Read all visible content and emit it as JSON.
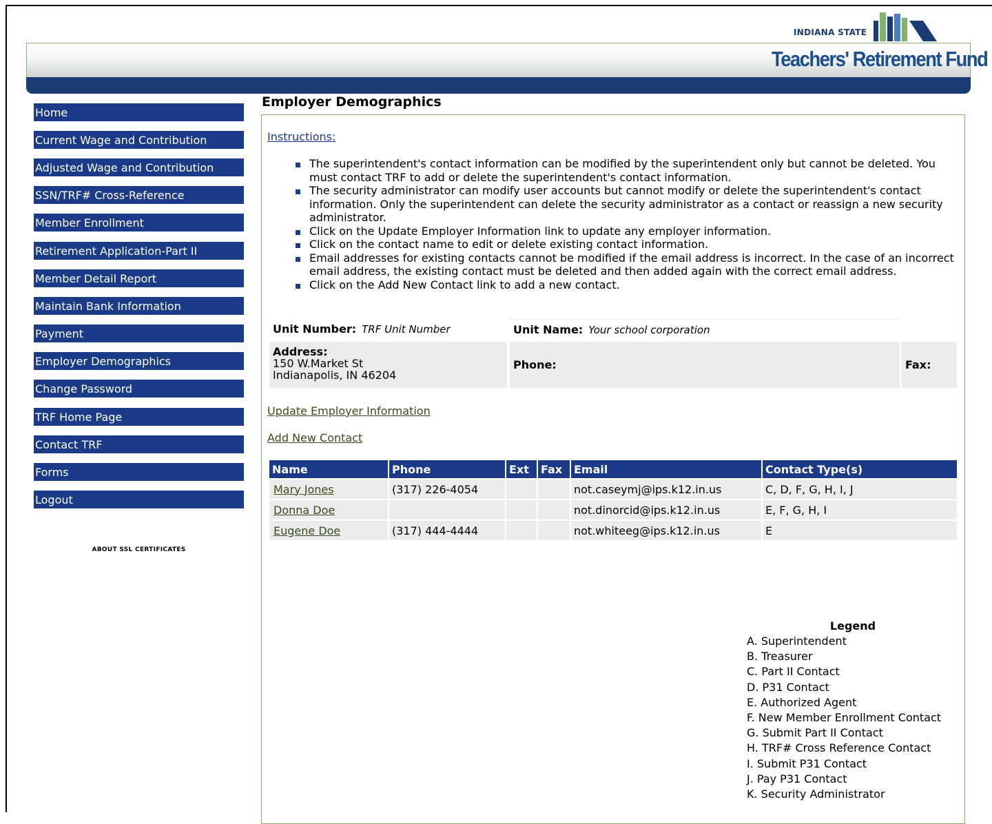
{
  "header": {
    "logo_top": "INDIANA STATE",
    "logo_name": "Teachers' Retirement Fund",
    "brand_color": "#1b3b73",
    "accent_color": "#7fb56a"
  },
  "sidebar": {
    "items": [
      {
        "label": "Home"
      },
      {
        "label": "Current Wage and Contribution"
      },
      {
        "label": "Adjusted Wage and Contribution"
      },
      {
        "label": "SSN/TRF# Cross-Reference"
      },
      {
        "label": "Member Enrollment"
      },
      {
        "label": "Retirement Application-Part II"
      },
      {
        "label": "Member Detail Report"
      },
      {
        "label": "Maintain Bank Information"
      },
      {
        "label": "Payment"
      },
      {
        "label": "Employer Demographics"
      },
      {
        "label": "Change Password"
      },
      {
        "label": "TRF Home Page"
      },
      {
        "label": "Contact TRF"
      },
      {
        "label": "Forms"
      },
      {
        "label": "Logout"
      }
    ],
    "ssl_text": "ABOUT SSL CERTIFICATES"
  },
  "main": {
    "title": "Employer Demographics",
    "instructions_link": "Instructions:",
    "instructions": [
      "The superintendent's contact information can be modified by the superintendent only but cannot be deleted. You must contact TRF to add or delete the superintendent's contact information.",
      "The security administrator can modify user accounts but cannot modify or delete the superintendent's contact information. Only the superintendent can delete the security administrator as a contact or reassign a new security administrator.",
      "Click on the Update Employer Information link to update any employer information.",
      "Click on the contact name to edit or delete existing contact information.",
      "Email addresses for existing contacts cannot be modified if the email address is incorrect. In the case of an incorrect email address, the existing contact must be deleted and then added again with the correct email address.",
      "Click on the Add New Contact link to add a new contact."
    ],
    "employer": {
      "unit_number_label": "Unit Number:",
      "unit_number_value": "TRF Unit Number",
      "unit_name_label": "Unit Name:",
      "unit_name_value": "Your school corporation",
      "address_label": "Address:",
      "address_line1": "150 W.Market St",
      "address_line2": "Indianapolis, IN 46204",
      "phone_label": "Phone:",
      "fax_label": "Fax:"
    },
    "update_link": "Update Employer Information",
    "add_contact_link": "Add New Contact",
    "contacts_table": {
      "headers": [
        "Name",
        "Phone",
        "Ext",
        "Fax",
        "Email",
        "Contact Type(s)"
      ],
      "rows": [
        {
          "name": "Mary Jones",
          "phone": "(317) 226-4054",
          "ext": "",
          "fax": "",
          "email": "not.caseymj@ips.k12.in.us",
          "types": "C, D, F, G, H, I, J"
        },
        {
          "name": "Donna Doe",
          "phone": "",
          "ext": "",
          "fax": "",
          "email": "not.dinorcid@ips.k12.in.us",
          "types": "E, F, G, H, I"
        },
        {
          "name": "Eugene Doe",
          "phone": "(317) 444-4444",
          "ext": "",
          "fax": "",
          "email": "not.whiteeg@ips.k12.in.us",
          "types": "E"
        }
      ]
    },
    "legend": {
      "title": "Legend",
      "items": [
        "A. Superintendent",
        "B. Treasurer",
        "C. Part II Contact",
        "D. P31 Contact",
        "E. Authorized Agent",
        "F. New Member Enrollment Contact",
        "G. Submit Part II Contact",
        "H. TRF# Cross Reference Contact",
        "I. Submit P31 Contact",
        "J. Pay P31 Contact",
        "K. Security Administrator"
      ]
    }
  }
}
